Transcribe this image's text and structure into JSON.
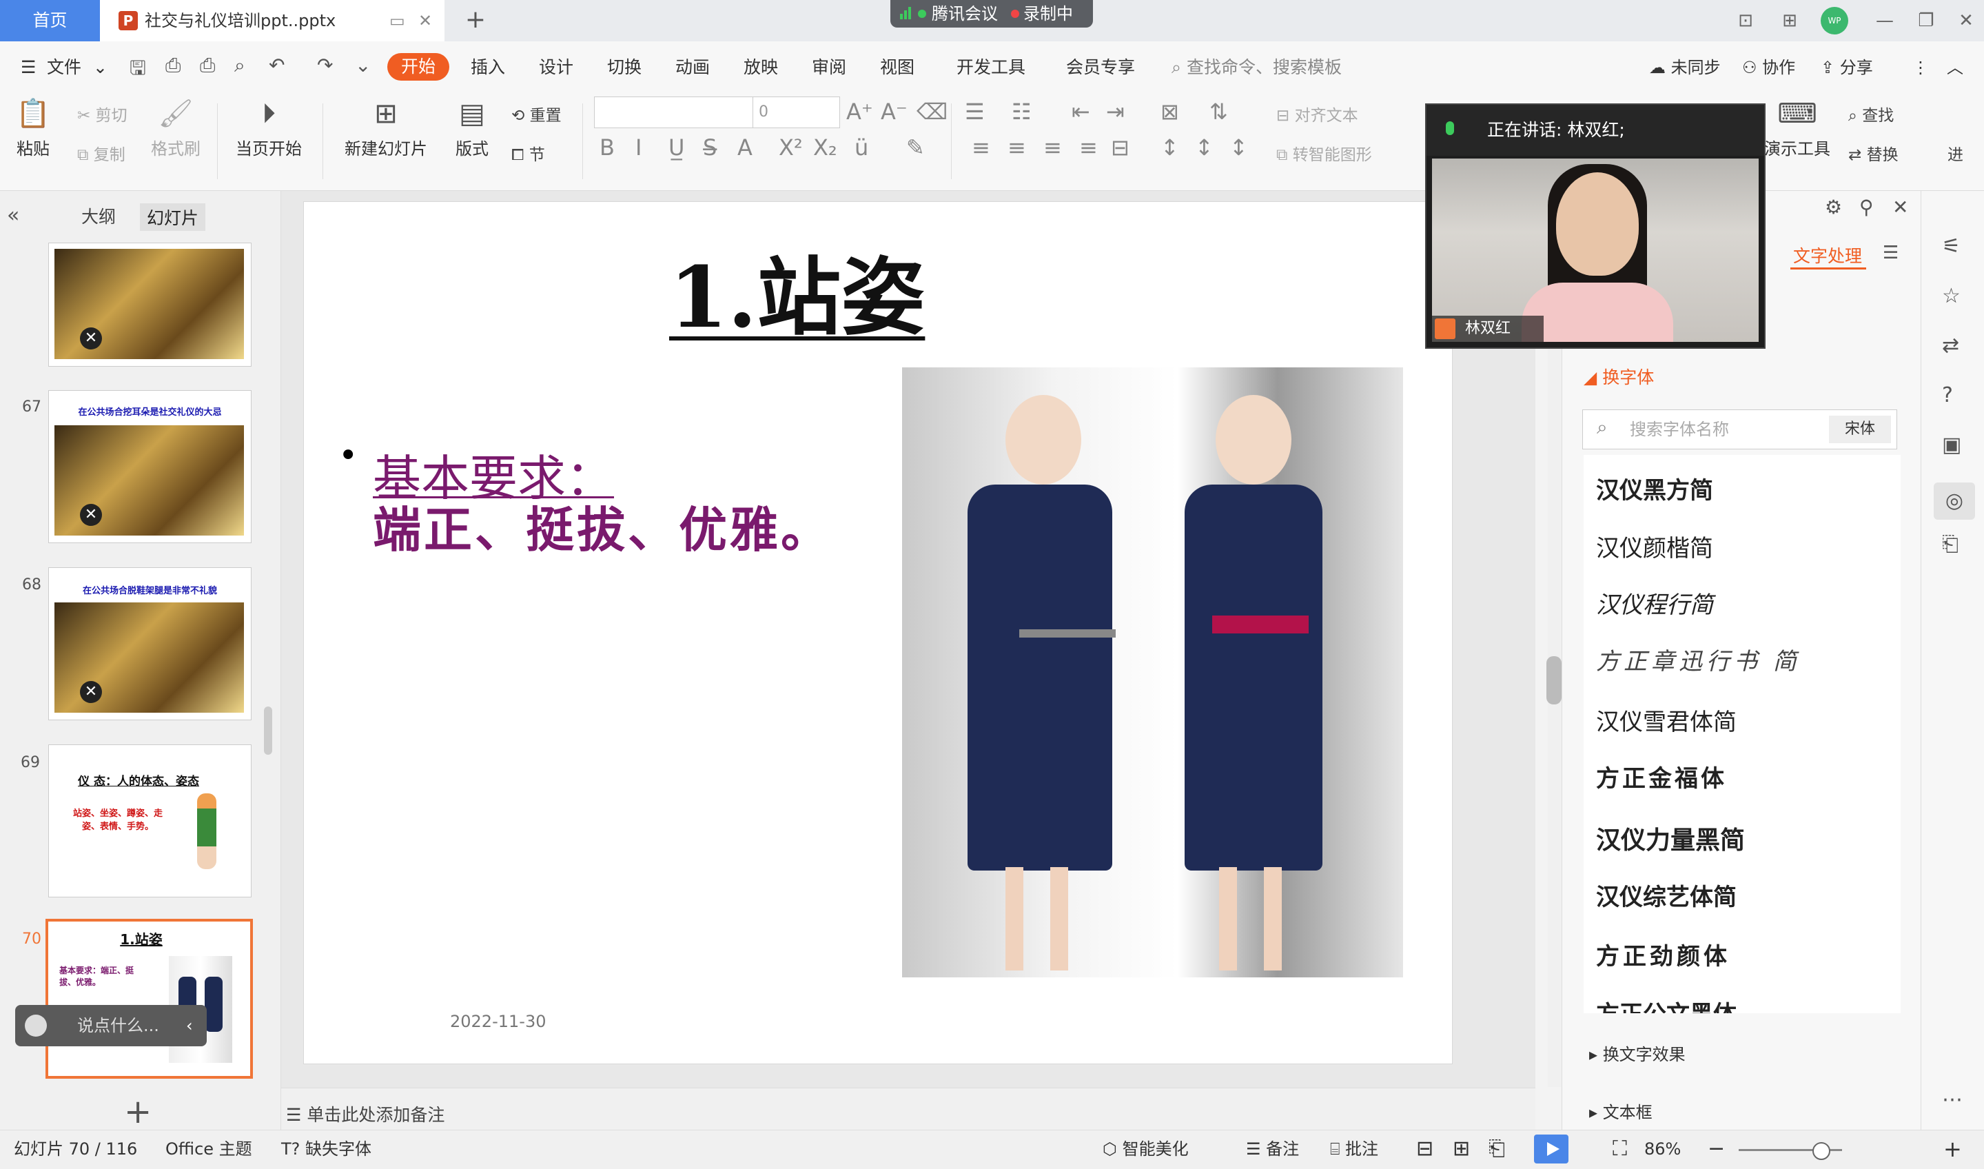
{
  "titlebar": {
    "home_tab": "首页",
    "doc_tab": "社交与礼仪培训ppt..pptx",
    "meeting_name": "腾讯会议",
    "recording": "录制中",
    "avatar": "WP"
  },
  "menu": {
    "file": "文件",
    "tabs": [
      "开始",
      "插入",
      "设计",
      "切换",
      "动画",
      "放映",
      "审阅",
      "视图",
      "开发工具",
      "会员专享"
    ],
    "search_placeholder": "查找命令、搜索模板",
    "unsynced": "未同步",
    "collaborate": "协作",
    "share": "分享"
  },
  "ribbon": {
    "paste": "粘贴",
    "cut": "剪切",
    "copy": "复制",
    "format_painter": "格式刷",
    "current_start": "当页开始",
    "new_slide": "新建幻灯片",
    "layout": "版式",
    "reset": "重置",
    "section": "节",
    "font_size": "0",
    "align_text": "对齐文本",
    "smart_shape": "转智能图形",
    "present_tools": "演示工具",
    "find": "查找",
    "replace": "替换",
    "more": "进"
  },
  "left_panel": {
    "tab_outline": "大纲",
    "tab_slides": "幻灯片",
    "thumbs": [
      {
        "num": "",
        "caption": ""
      },
      {
        "num": "67",
        "caption": "在公共场合挖耳朵是社交礼仪的大忌"
      },
      {
        "num": "68",
        "caption": "在公共场合脱鞋架腿是非常不礼貌"
      },
      {
        "num": "69",
        "caption": "仪 态：人的体态、姿态",
        "sub": "站姿、坐姿、蹲姿、走姿、表情、手势。"
      },
      {
        "num": "70",
        "caption": "1.站姿",
        "sub": "基本要求：端正、挺拔、优雅。"
      }
    ],
    "comment_placeholder": "说点什么..."
  },
  "slide": {
    "title": "1.站姿",
    "bullet_line1": "基本要求：",
    "bullet_line2": "端正、挺拔、优雅。",
    "date": "2022-11-30"
  },
  "notes": {
    "placeholder": "单击此处添加备注"
  },
  "video": {
    "speaking": "正在讲话: 林双红;",
    "name": "林双红"
  },
  "right_pane": {
    "title": "文字处理",
    "section_font": "换字体",
    "search_placeholder": "搜索字体名称",
    "current_font": "宋体",
    "fonts": [
      "汉仪黑方简",
      "汉仪颜楷简",
      "汉仪程行简",
      "方正章迅行书 简",
      "汉仪雪君体简",
      "方正金福体",
      "汉仪力量黑简",
      "汉仪综艺体简",
      "方正劲颜体",
      "方正公文黑体"
    ],
    "section_effect": "换文字效果",
    "section_textbox": "文本框"
  },
  "status": {
    "slide_info": "幻灯片 70 / 116",
    "theme": "Office 主题",
    "missing_font": "缺失字体",
    "beautify": "智能美化",
    "notes": "备注",
    "comments": "批注",
    "zoom": "86%"
  },
  "colors": {
    "accent": "#f05d22",
    "home_blue": "#4a86e8",
    "slide_text": "#7a1a6d"
  }
}
